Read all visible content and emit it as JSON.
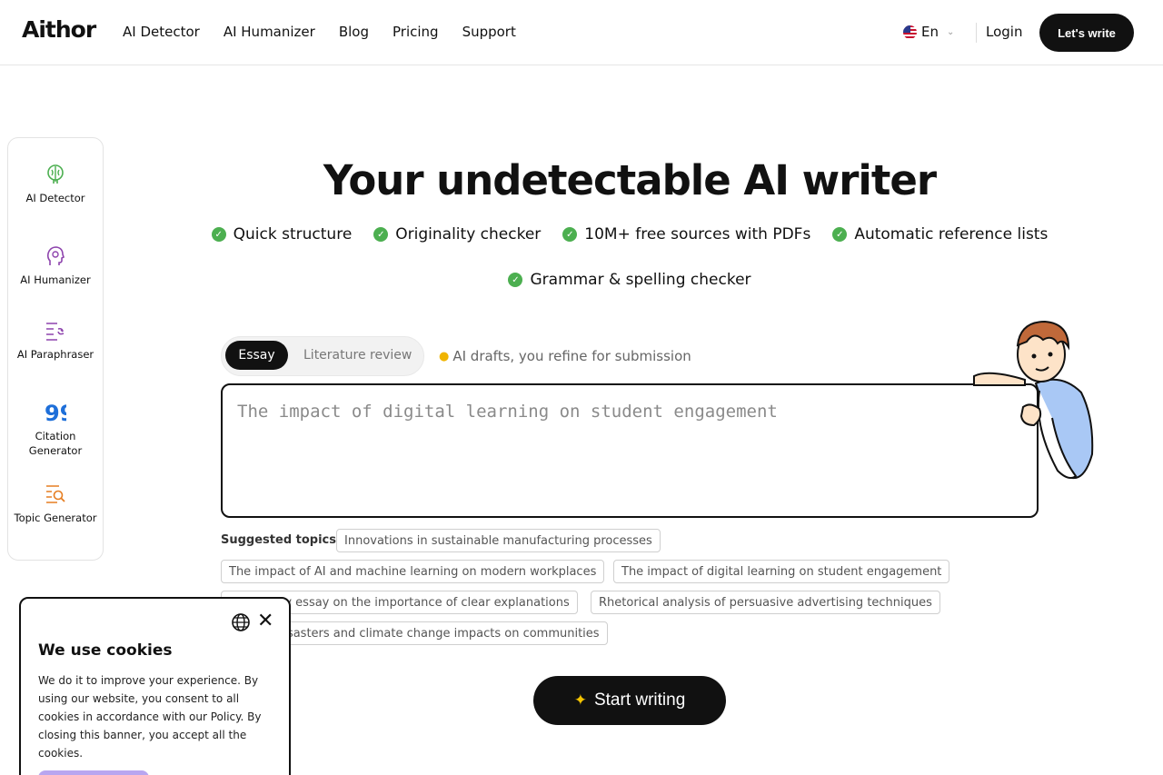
{
  "header": {
    "logo": "Aithor",
    "nav": [
      "AI Detector",
      "AI Humanizer",
      "Blog",
      "Pricing",
      "Support"
    ],
    "language": "En",
    "login": "Login",
    "cta": "Let's write"
  },
  "sidebar": {
    "items": [
      {
        "label": "AI Detector",
        "icon": "brain-icon",
        "color": "#4caf50"
      },
      {
        "label": "AI Humanizer",
        "icon": "head-icon",
        "color": "#8e44ad"
      },
      {
        "label": "AI Paraphraser",
        "icon": "paraphrase-icon",
        "color": "#8e44ad"
      },
      {
        "label": "Citation Generator",
        "icon": "quote-icon",
        "color": "#1e6fd9"
      },
      {
        "label": "Topic Generator",
        "icon": "search-list-icon",
        "color": "#e67e22"
      }
    ]
  },
  "hero": {
    "title": "Your undetectable AI writer",
    "features": [
      "Quick structure",
      "Originality checker",
      "10M+ free sources with PDFs",
      "Automatic reference lists",
      "Grammar & spelling checker"
    ]
  },
  "editor": {
    "tabs": [
      "Essay",
      "Literature review"
    ],
    "hint": "AI drafts, you refine for submission",
    "placeholder": "The impact of digital learning on student engagement"
  },
  "suggestions": {
    "label": "Suggested topics",
    "topics": [
      "Innovations in sustainable manufacturing processes",
      "The impact of AI and machine learning on modern workplaces",
      "The impact of digital learning on student engagement",
      "Exemplary essay on the importance of clear explanations",
      "Rhetorical analysis of persuasive advertising techniques",
      "Natural disasters and climate change impacts on communities"
    ]
  },
  "start_button": "Start writing",
  "cookie": {
    "title": "We use cookies",
    "text": "We do it to improve your experience. By using our website, you consent to all cookies in accordance with our Policy. By closing this banner, you accept all the cookies."
  },
  "colors": {
    "accent": "#111111",
    "check_green": "#4caf50",
    "cookie_button": "#b8a6f0"
  }
}
